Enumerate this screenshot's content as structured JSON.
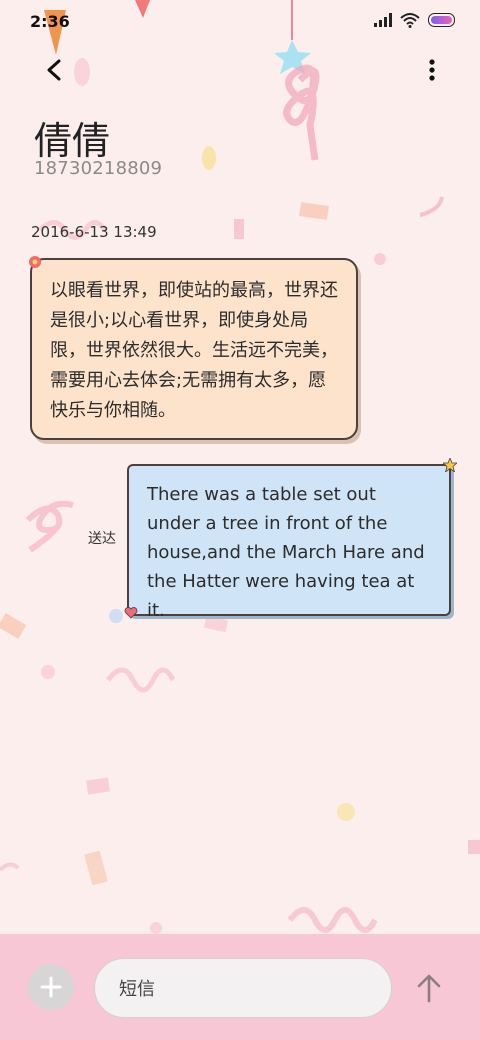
{
  "status_bar": {
    "time": "2:36"
  },
  "contact": {
    "name": "倩倩",
    "number": "18730218809"
  },
  "thread": {
    "timestamp": "2016-6-13 13:49",
    "incoming_message": "以眼看世界，即使站的最高，世界还是很小;以心看世界，即使身处局限，世界依然很大。生活远不完美，需要用心去体会;无需拥有太多，愿快乐与你相随。",
    "outgoing_message": "There was a table set out under a tree in front of the house,and the March Hare and the Hatter were having tea at it.",
    "delivery_status": "送达"
  },
  "composer": {
    "placeholder": "短信"
  },
  "colors": {
    "background": "#fdeeee",
    "incoming_bubble": "#fde3cb",
    "outgoing_bubble": "#cfe4f7",
    "bottom_bar": "#f7c7d5"
  }
}
